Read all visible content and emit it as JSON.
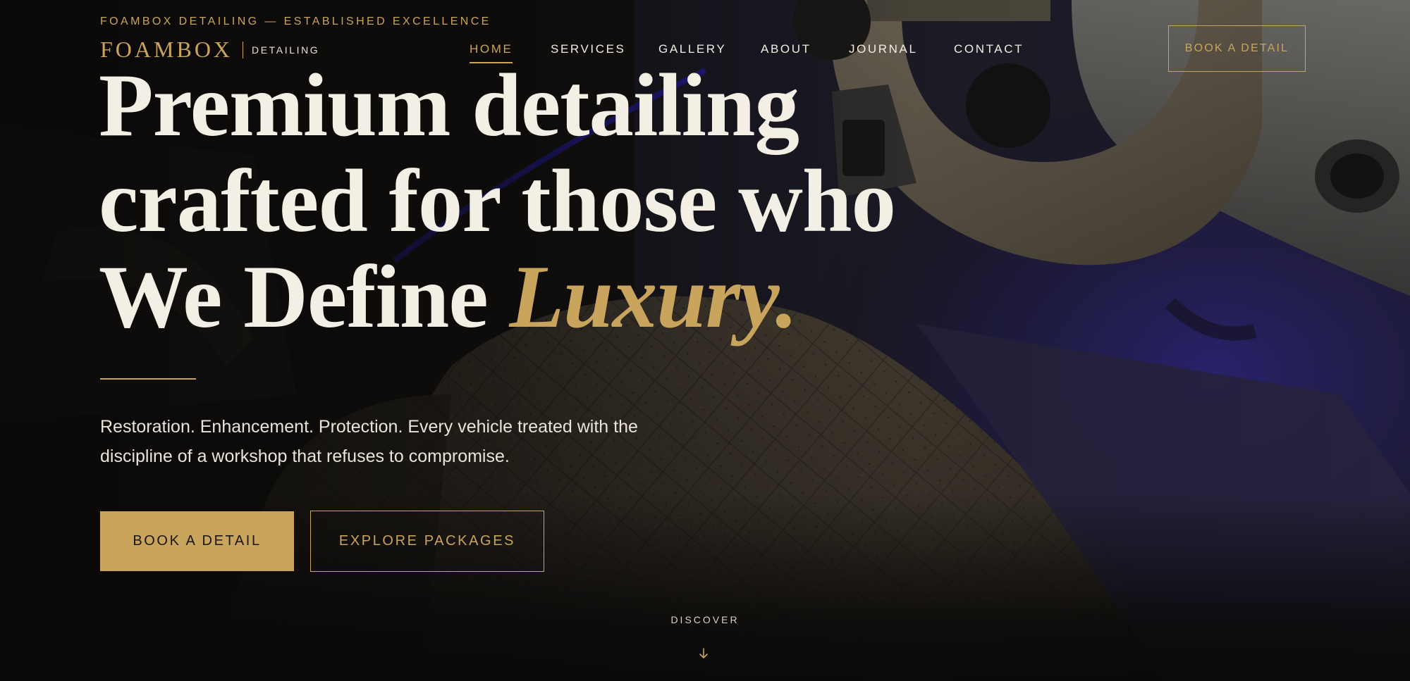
{
  "page": {
    "eyebrow": "FOAMBOX DETAILING — ESTABLISHED EXCELLENCE",
    "brand": {
      "name": "FOAMBOX",
      "sub": "DETAILING"
    },
    "nav": {
      "items": [
        {
          "label": "HOME",
          "active": true
        },
        {
          "label": "SERVICES"
        },
        {
          "label": "GALLERY"
        },
        {
          "label": "ABOUT"
        },
        {
          "label": "JOURNAL"
        },
        {
          "label": "CONTACT"
        }
      ]
    },
    "header_cta": "BOOK A DETAIL"
  },
  "hero": {
    "headline_line1": "Premium detailing",
    "headline_line2": "crafted for those who",
    "headline_line3_start": "We Define ",
    "headline_line3_accent": "Luxury.",
    "lede": "Restoration. Enhancement. Protection. Every vehicle treated with the discipline of a workshop that refuses to compromise.",
    "primary_button": "BOOK A DETAIL",
    "secondary_button": "EXPLORE PACKAGES",
    "scroll_label": "DISCOVER",
    "scroll_icon": "arrow-down-icon"
  },
  "colors": {
    "accent": "#c9a45d",
    "background": "#0c0b0a",
    "text": "#f3efe6",
    "ambient_light": "#3a30c8"
  }
}
